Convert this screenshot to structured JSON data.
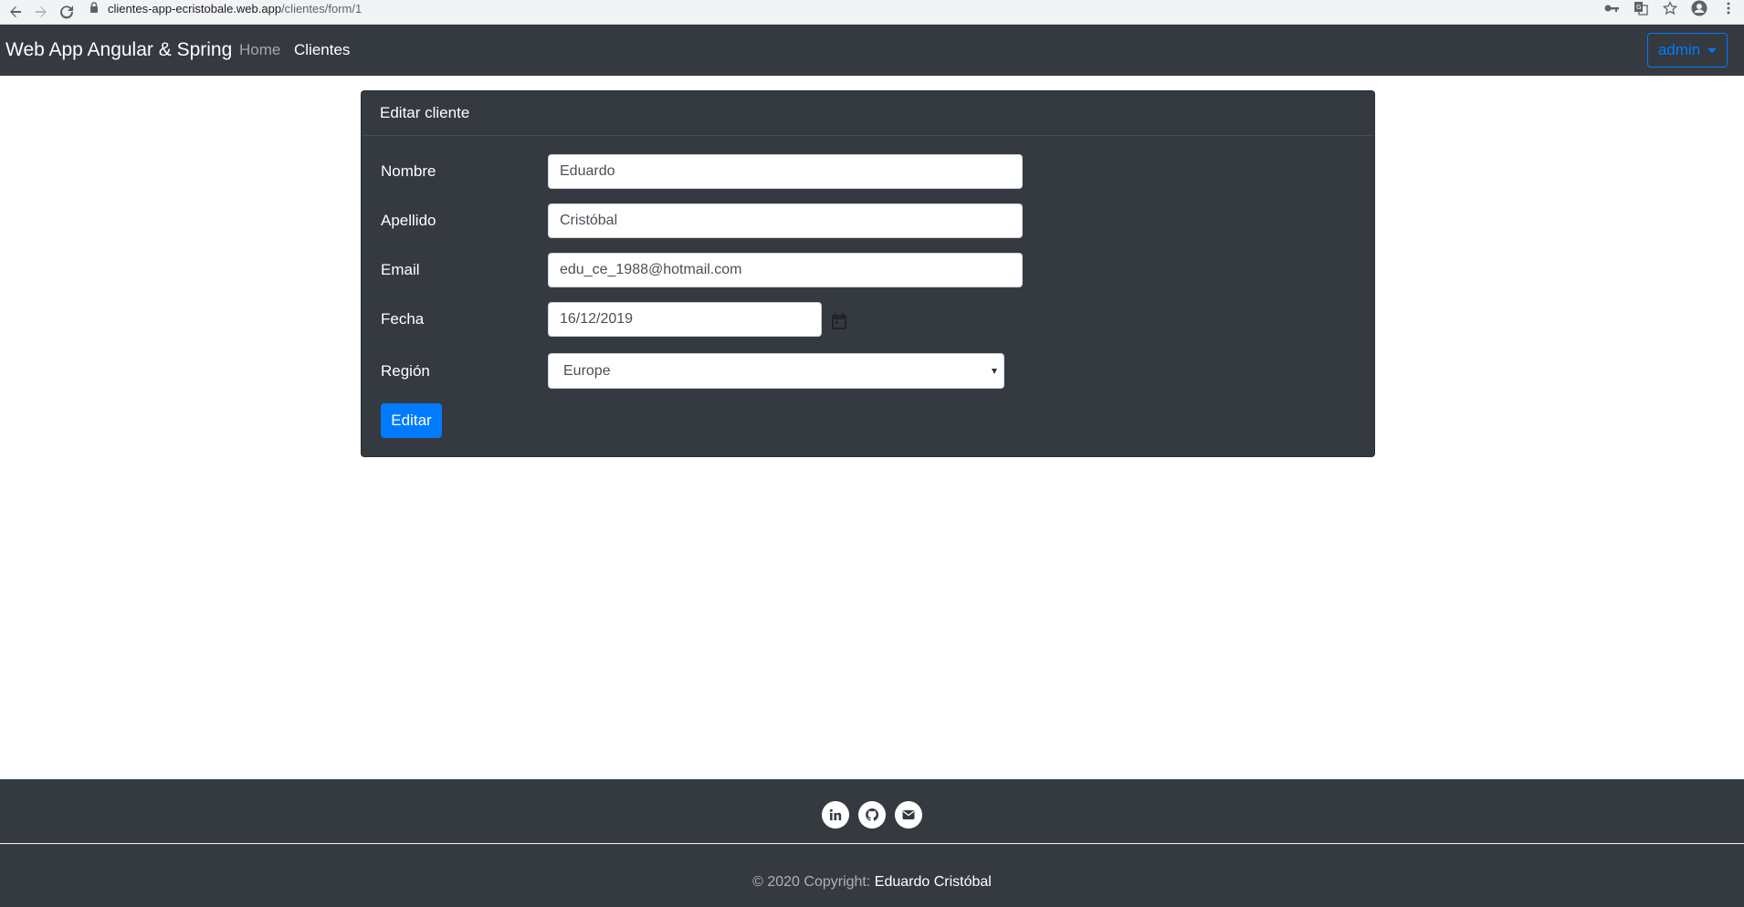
{
  "browser": {
    "url_domain": "clientes-app-ecristobale.web.app",
    "url_path": "/clientes/form/1"
  },
  "navbar": {
    "brand": "Web App Angular & Spring",
    "links": [
      {
        "label": "Home",
        "active": false
      },
      {
        "label": "Clientes",
        "active": true
      }
    ],
    "user_menu": "admin"
  },
  "form": {
    "title": "Editar cliente",
    "fields": {
      "nombre": {
        "label": "Nombre",
        "value": "Eduardo"
      },
      "apellido": {
        "label": "Apellido",
        "value": "Cristóbal"
      },
      "email": {
        "label": "Email",
        "value": "edu_ce_1988@hotmail.com"
      },
      "fecha": {
        "label": "Fecha",
        "value": "16/12/2019"
      },
      "region": {
        "label": "Región",
        "value": "Europe"
      }
    },
    "submit_label": "Editar"
  },
  "footer": {
    "social": [
      "linkedin-icon",
      "github-icon",
      "email-icon"
    ],
    "copyright_prefix": "© 2020 Copyright:",
    "copyright_author": "Eduardo Cristóbal"
  },
  "colors": {
    "dark": "#343a40",
    "primary": "#007bff"
  }
}
